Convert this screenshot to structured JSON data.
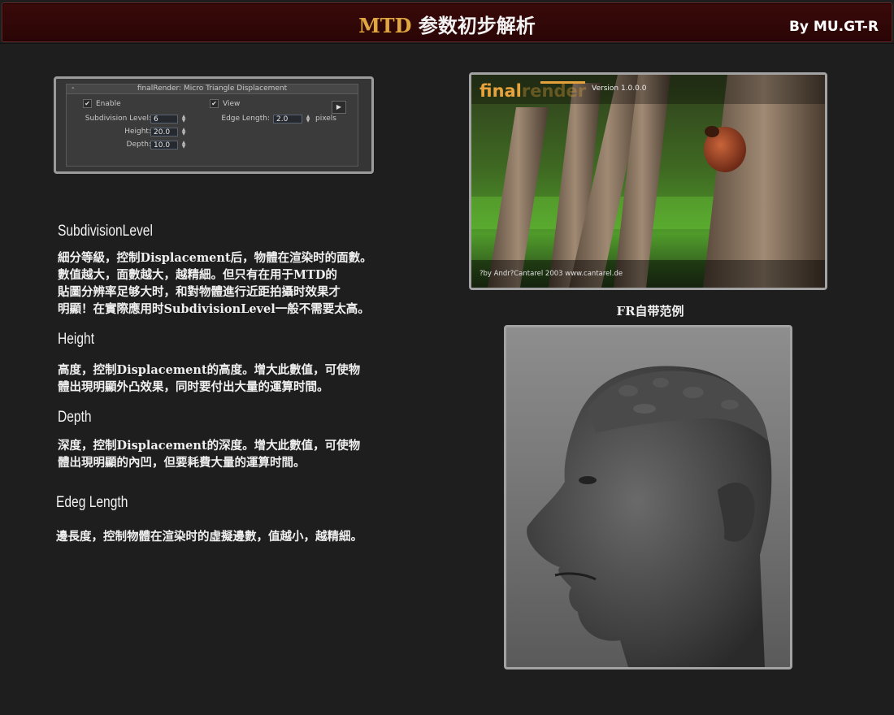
{
  "header": {
    "title_mtd": "MTD",
    "title_rest": " 参数初步解析",
    "author": "By MU.GT-R"
  },
  "panel": {
    "title": "finalRender: Micro Triangle Displacement",
    "collapse": "-",
    "enable_label": "Enable",
    "view_label": "View",
    "subdivision_label": "Subdivision Level:",
    "subdivision_value": "6",
    "height_label": "Height:",
    "height_value": "20.0",
    "depth_label": "Depth:",
    "depth_value": "10.0",
    "edge_label": "Edge Length:",
    "edge_value": "2.0",
    "edge_unit": "pixels"
  },
  "sections": {
    "subdivision": {
      "title": "SubdivisionLevel",
      "body": "細分等級，控制Displacement后，物體在渲染时的面數。\n數值越大，面數越大，越精細。但只有在用于MTD的\n貼圖分辨率足够大时，和對物體進行近距拍攝时效果才\n明顯！在實際應用时SubdivisionLevel一般不需要太高。"
    },
    "height": {
      "title": "Height",
      "body": "高度，控制Displacement的高度。增大此數值，可使物\n體出現明顯外凸效果，同时要付出大量的運算时間。"
    },
    "depth": {
      "title": "Depth",
      "body": "深度，控制Displacement的深度。增大此數值，可使物\n體出現明顯的內凹，但要耗費大量的運算时間。"
    },
    "edge": {
      "title": "Edeg Length",
      "body": "邊長度，控制物體在渲染时的虛擬邊數，值越小，越精細。"
    }
  },
  "splash": {
    "logo_final": "final",
    "logo_render": "render",
    "version": "Version 1.0.0.0",
    "credit": "?by Andr?Cantarel 2003 www.cantarel.de",
    "caption": "FR自带范例"
  },
  "colors": {
    "header_bg": "#2a0505",
    "mtd_accent": "#e0a640",
    "logo_orange": "#e6a23c",
    "background": "#1e1e1e"
  }
}
